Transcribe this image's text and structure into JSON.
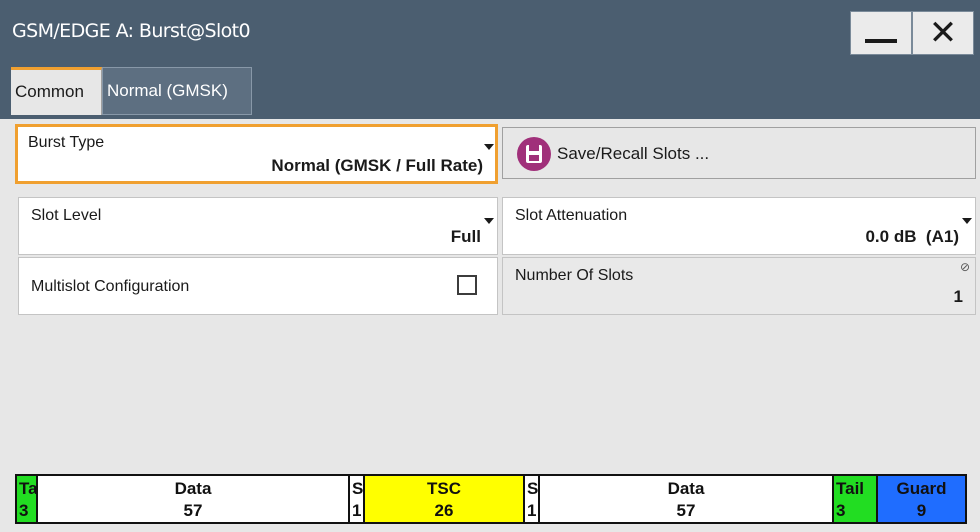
{
  "window": {
    "title": "GSM/EDGE A: Burst@Slot0"
  },
  "title_buttons": {
    "minimize_icon": "minimize-icon",
    "close_icon": "close-icon",
    "close_glyph": "✕"
  },
  "tabs": [
    {
      "label": "Common",
      "active": true
    },
    {
      "label": "Normal (GMSK)",
      "active": false
    }
  ],
  "burst_type": {
    "label": "Burst Type",
    "value": "Normal (GMSK / Full Rate)"
  },
  "save_recall": {
    "label": "Save/Recall Slots ...",
    "icon": "save-icon",
    "icon_color": "#a0307a"
  },
  "slot_level": {
    "label": "Slot Level",
    "value": "Full"
  },
  "slot_attenuation": {
    "label": "Slot Attenuation",
    "value": "0.0 dB  (A1)"
  },
  "multislot": {
    "label": "Multislot Configuration",
    "checked": false
  },
  "number_of_slots": {
    "label": "Number Of Slots",
    "value": "1",
    "icon": "read-only-icon"
  },
  "burst_segments": [
    {
      "name": "Tail",
      "count": "3",
      "color": "#22dd22"
    },
    {
      "name": "Data",
      "count": "57",
      "color": "#ffffff"
    },
    {
      "name": "S",
      "count": "1",
      "color": "#ffffff"
    },
    {
      "name": "TSC",
      "count": "26",
      "color": "#ffff00"
    },
    {
      "name": "S",
      "count": "1",
      "color": "#ffffff"
    },
    {
      "name": "Data",
      "count": "57",
      "color": "#ffffff"
    },
    {
      "name": "Tail",
      "count": "3",
      "color": "#22dd22"
    },
    {
      "name": "Guard",
      "count": "9",
      "color": "#1f6dff"
    }
  ],
  "colors": {
    "titlebar": "#4b5e70",
    "focus_border": "#f0a030"
  }
}
